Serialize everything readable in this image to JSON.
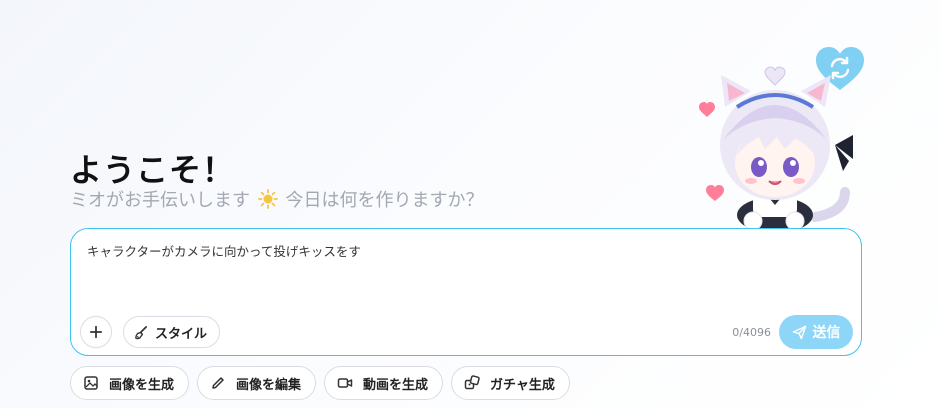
{
  "header": {
    "title": "ようこそ！",
    "subtitle_before": "ミオがお手伝いします",
    "subtitle_after": "今日は何を作りますか？"
  },
  "prompt": {
    "value": "キャラクターがカメラに向かって投げキッスをす",
    "placeholder": "",
    "char_count": "0/4096",
    "style_label": "スタイル",
    "send_label": "送信"
  },
  "actions": [
    {
      "label": "画像を生成",
      "icon": "image-icon"
    },
    {
      "label": "画像を編集",
      "icon": "pencil-icon"
    },
    {
      "label": "動画を生成",
      "icon": "video-icon"
    },
    {
      "label": "ガチャ生成",
      "icon": "dice-icon"
    }
  ],
  "colors": {
    "accent": "#3fc3ef",
    "send_button": "#8dd6f7",
    "heart_button": "#7fd0f2",
    "muted_text": "#a3a8b2"
  }
}
